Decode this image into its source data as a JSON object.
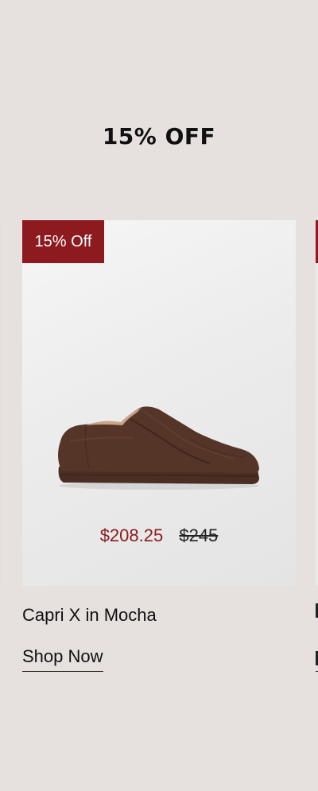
{
  "promo": {
    "headline": "15% OFF"
  },
  "product": {
    "badge": "15% Off",
    "sale_price": "$208.25",
    "original_price": "$245",
    "name": "Capri X in Mocha",
    "cta_label": "Shop Now",
    "image_alt": "Capri X sneaker in mocha brown leather"
  },
  "colors": {
    "background": "#e6e1de",
    "badge": "#8c1a1e",
    "sale_price": "#8c1a1e",
    "text": "#111111"
  }
}
